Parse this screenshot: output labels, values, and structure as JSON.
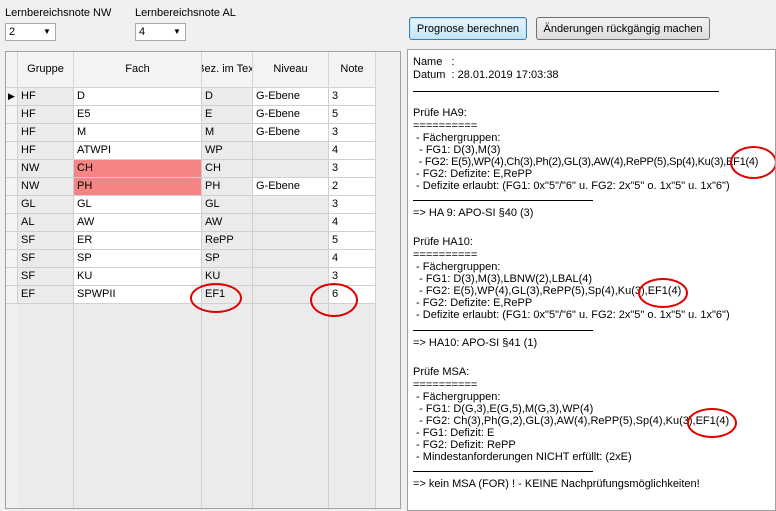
{
  "filters": {
    "nw": {
      "label": "Lernbereichsnote NW",
      "value": "2"
    },
    "al": {
      "label": "Lernbereichsnote AL",
      "value": "4"
    }
  },
  "buttons": {
    "prognose": "Prognose berechnen",
    "undo": "Änderungen rückgängig machen"
  },
  "table": {
    "headers": [
      "Gruppe",
      "Fach",
      "Bez. im Text",
      "Niveau",
      "Note"
    ],
    "rows": [
      {
        "gruppe": "HF",
        "fach": "D",
        "bez": "D",
        "niveau": "G-Ebene",
        "note": "3"
      },
      {
        "gruppe": "HF",
        "fach": "E5",
        "bez": "E",
        "niveau": "G-Ebene",
        "note": "5"
      },
      {
        "gruppe": "HF",
        "fach": "M",
        "bez": "M",
        "niveau": "G-Ebene",
        "note": "3"
      },
      {
        "gruppe": "HF",
        "fach": "ATWPI",
        "bez": "WP",
        "niveau": "",
        "note": "4"
      },
      {
        "gruppe": "NW",
        "fach": "CH",
        "bez": "CH",
        "niveau": "",
        "note": "3"
      },
      {
        "gruppe": "NW",
        "fach": "PH",
        "bez": "PH",
        "niveau": "G-Ebene",
        "note": "2"
      },
      {
        "gruppe": "GL",
        "fach": "GL",
        "bez": "GL",
        "niveau": "",
        "note": "3"
      },
      {
        "gruppe": "AL",
        "fach": "AW",
        "bez": "AW",
        "niveau": "",
        "note": "4"
      },
      {
        "gruppe": "SF",
        "fach": "ER",
        "bez": "RePP",
        "niveau": "",
        "note": "5"
      },
      {
        "gruppe": "SF",
        "fach": "SP",
        "bez": "SP",
        "niveau": "",
        "note": "4"
      },
      {
        "gruppe": "SF",
        "fach": "KU",
        "bez": "KU",
        "niveau": "",
        "note": "3"
      },
      {
        "gruppe": "EF",
        "fach": "SPWPII",
        "bez": "EF1",
        "niveau": "",
        "note": "6"
      }
    ]
  },
  "report": {
    "name": "Name   :",
    "datum": "Datum  : 28.01.2019 17:03:38",
    "ha9": {
      "title": "Prüfe HA9:",
      "sep": "==========",
      "l1": " - Fächergruppen:",
      "l2": "  - FG1: D(3),M(3)",
      "l3": "  - FG2: E(5),WP(4),Ch(3),Ph(2),GL(3),AW(4),RePP(5),Sp(4),Ku(3),EF1(4)",
      "l4": " - FG2: Defizite: E,RePP",
      "l5": " - Defizite erlaubt: (FG1: 0x\"5\"/\"6\" u. FG2: 2x\"5\" o. 1x\"5\" u. 1x\"6\")",
      "result": "=> HA 9: APO-SI §40 (3)"
    },
    "ha10": {
      "title": "Prüfe HA10:",
      "sep": "==========",
      "l1": " - Fächergruppen:",
      "l2": "  - FG1: D(3),M(3),LBNW(2),LBAL(4)",
      "l3": "  - FG2: E(5),WP(4),GL(3),RePP(5),Sp(4),Ku(3),EF1(4)",
      "l4": " - FG2: Defizite: E,RePP",
      "l5": " - Defizite erlaubt: (FG1: 0x\"5\"/\"6\" u. FG2: 2x\"5\" o. 1x\"5\" u. 1x\"6\")",
      "result": "=> HA10: APO-SI §41 (1)"
    },
    "msa": {
      "title": "Prüfe MSA:",
      "sep": "==========",
      "l1": " - Fächergruppen:",
      "l2": "  - FG1: D(G,3),E(G,5),M(G,3),WP(4)",
      "l3": "  - FG2: Ch(3),Ph(G,2),GL(3),AW(4),RePP(5),Sp(4),Ku(3),EF1(4)",
      "l4": " - FG1: Defizit: E",
      "l5": " - FG2: Defizit: RePP",
      "l6": " - Mindestanforderungen NICHT erfüllt: (2xE)",
      "result": "=> kein MSA (FOR) ! - KEINE Nachprüfungsmöglichkeiten!"
    }
  }
}
